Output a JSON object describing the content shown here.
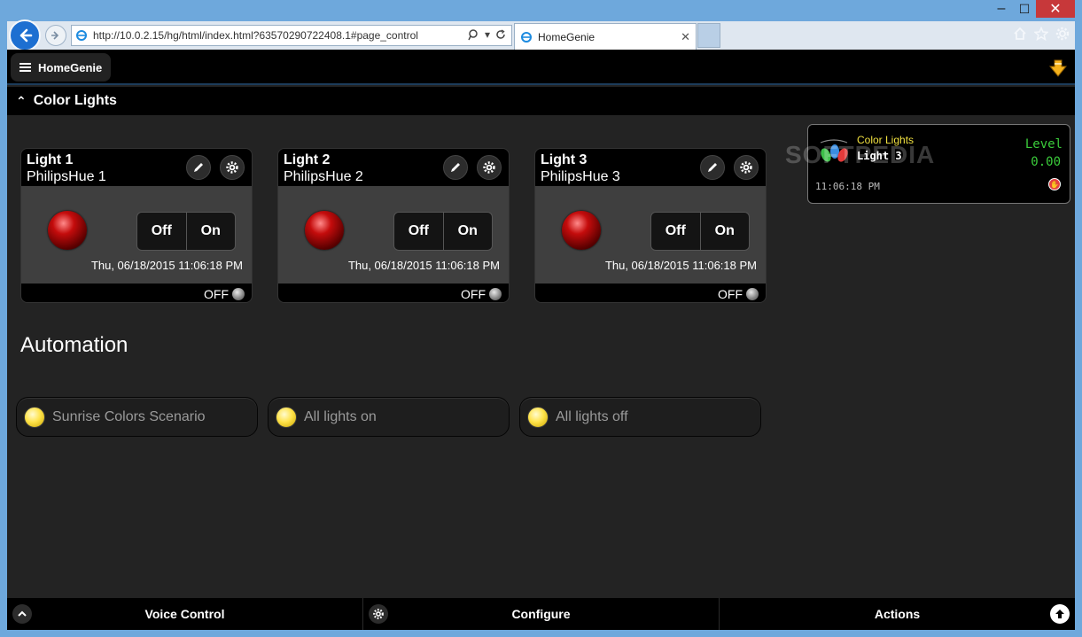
{
  "browser": {
    "url": "http://10.0.2.15/hg/html/index.html?63570290722408.1#page_control",
    "tab_title": "HomeGenie"
  },
  "header": {
    "menu_label": "HomeGenie"
  },
  "group": {
    "title": "Color Lights"
  },
  "modules": [
    {
      "name": "Light 1",
      "description": "PhilipsHue 1",
      "off_label": "Off",
      "on_label": "On",
      "date": "Thu, 06/18/2015 11:06:18 PM",
      "status": "OFF"
    },
    {
      "name": "Light 2",
      "description": "PhilipsHue 2",
      "off_label": "Off",
      "on_label": "On",
      "date": "Thu, 06/18/2015 11:06:18 PM",
      "status": "OFF"
    },
    {
      "name": "Light 3",
      "description": "PhilipsHue 3",
      "off_label": "Off",
      "on_label": "On",
      "date": "Thu, 06/18/2015 11:06:18 PM",
      "status": "OFF"
    }
  ],
  "popup": {
    "group": "Color Lights",
    "name": "Light 3",
    "label": "Level",
    "value": "0.00",
    "time": "11:06:18 PM"
  },
  "watermark": "SOFTPEDIA",
  "automation": {
    "title": "Automation",
    "programs": [
      "Sunrise Colors Scenario",
      "All lights on",
      "All lights off"
    ]
  },
  "footer": {
    "voice_control": "Voice Control",
    "configure": "Configure",
    "actions": "Actions"
  },
  "colors": {
    "background": "#232323",
    "bar": "#000000",
    "led_off_red": "#c40c0c",
    "level_green": "#3bcc3b",
    "popup_group_yellow": "#f0e040"
  }
}
